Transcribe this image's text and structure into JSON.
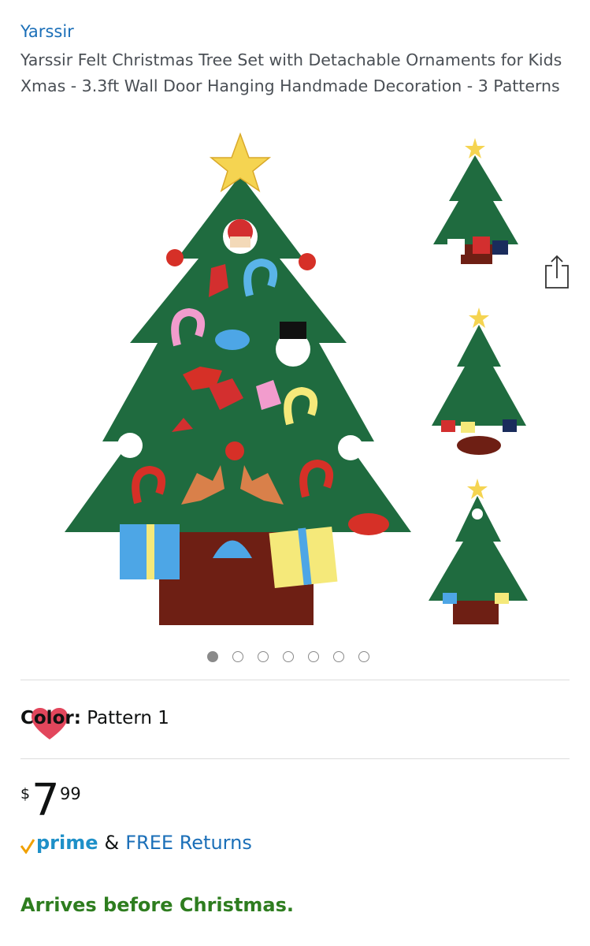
{
  "header": {
    "brand": "Yarssir",
    "title": "Yarssir Felt Christmas Tree Set with Detachable Ornaments for Kids Xmas - 3.3ft Wall Door Hanging Handmade Decoration - 3 Patterns"
  },
  "gallery": {
    "image_count": 7,
    "active_index": 0,
    "icons": {
      "share": "share-icon",
      "favorite": "heart-icon"
    }
  },
  "variation": {
    "label": "Color:",
    "value": "Pattern 1"
  },
  "price": {
    "symbol": "$",
    "whole": "7",
    "fraction": "99"
  },
  "shipping": {
    "prime_label": "prime",
    "amp": "&",
    "returns_label": "FREE Returns"
  },
  "delivery": {
    "message": "Arrives before Christmas."
  },
  "colors": {
    "link": "#1b6fb8",
    "delivery": "#2e7d1f",
    "prime": "#1e90c8",
    "prime_check": "#f0a000",
    "heart": "#e2465c"
  }
}
